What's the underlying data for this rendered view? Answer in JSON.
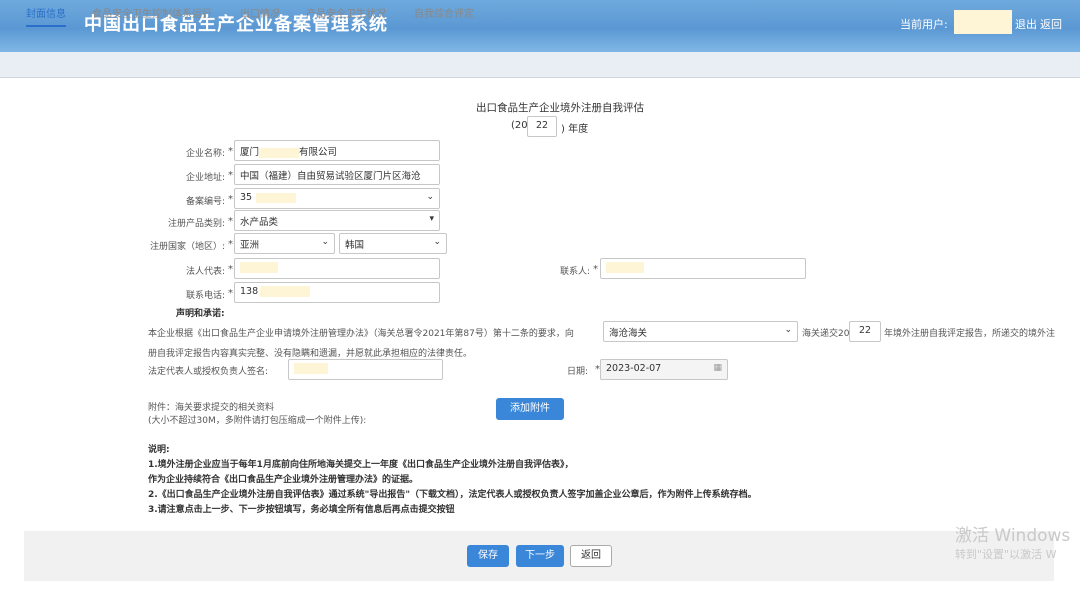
{
  "header": {
    "system_title": "中国出口食品生产企业备案管理系统",
    "current_user_label": "当前用户:",
    "logout": "退出",
    "back": "返回"
  },
  "tabs": [
    {
      "label": "封面信息",
      "active": true
    },
    {
      "label": "食品安全卫生控制体系运行",
      "active": false
    },
    {
      "label": "出口情况",
      "active": false
    },
    {
      "label": "产品安全卫生状况",
      "active": false
    },
    {
      "label": "自我综合评定",
      "active": false
    }
  ],
  "form": {
    "title": "出口食品生产企业境外注册自我评估",
    "year_prefix": "(20",
    "year_value": "22",
    "year_suffix": ") 年度",
    "company_name_label": "企业名称:",
    "company_name_value_a": "厦门",
    "company_name_value_b": "有限公司",
    "address_label": "企业地址:",
    "address_value": "中国（福建）自由贸易试验区厦门片区海沧",
    "record_no_label": "备案编号:",
    "record_no_value": "35",
    "product_category_label": "注册产品类别:",
    "product_category_value": "水产品类",
    "country_label": "注册国家（地区）:",
    "region_value": "亚洲",
    "country_value": "韩国",
    "legal_rep_label": "法人代表:",
    "contact_label": "联系人:",
    "phone_label": "联系电话:",
    "phone_value": "138",
    "required_mark": "*"
  },
  "declaration": {
    "heading": "声明和承诺:",
    "text_part1": "本企业根据《出口食品生产企业申请境外注册管理办法》（海关总署令2021年第87号）第十二条的要求，向",
    "customs_value": "海沧海关",
    "text_part2": "海关递交20",
    "year_value": "22",
    "text_part3": "年境外注册自我评定报告，所递交的境外注",
    "text_line2": "册自我评定报告内容真实完整、没有隐瞒和遗漏，并愿就此承担相应的法律责任。",
    "signer_label": "法定代表人或授权负责人签名:",
    "date_label": "日期:",
    "date_value": "2023-02-07"
  },
  "attachment": {
    "line1": "附件：海关要求提交的相关资料",
    "line2": "(大小不超过30M，多附件请打包压缩成一个附件上传):",
    "add_button": "添加附件"
  },
  "notes": {
    "heading": "说明:",
    "items": [
      "1.境外注册企业应当于每年1月底前向住所地海关提交上一年度《出口食品生产企业境外注册自我评估表》，",
      "作为企业持续符合《出口食品生产企业境外注册管理办法》的证据。",
      "2.《出口食品生产企业境外注册自我评估表》通过系统\"导出报告\"（下载文档），法定代表人或授权负责人签字加盖企业公章后，作为附件上传系统存档。",
      "3.请注意点击上一步、下一步按钮填写，务必填全所有信息后再点击提交按钮"
    ]
  },
  "footer": {
    "save": "保存",
    "next": "下一步",
    "back": "返回"
  },
  "watermark": {
    "line1": "激活 Windows",
    "line2": "转到\"设置\"以激活 W"
  }
}
